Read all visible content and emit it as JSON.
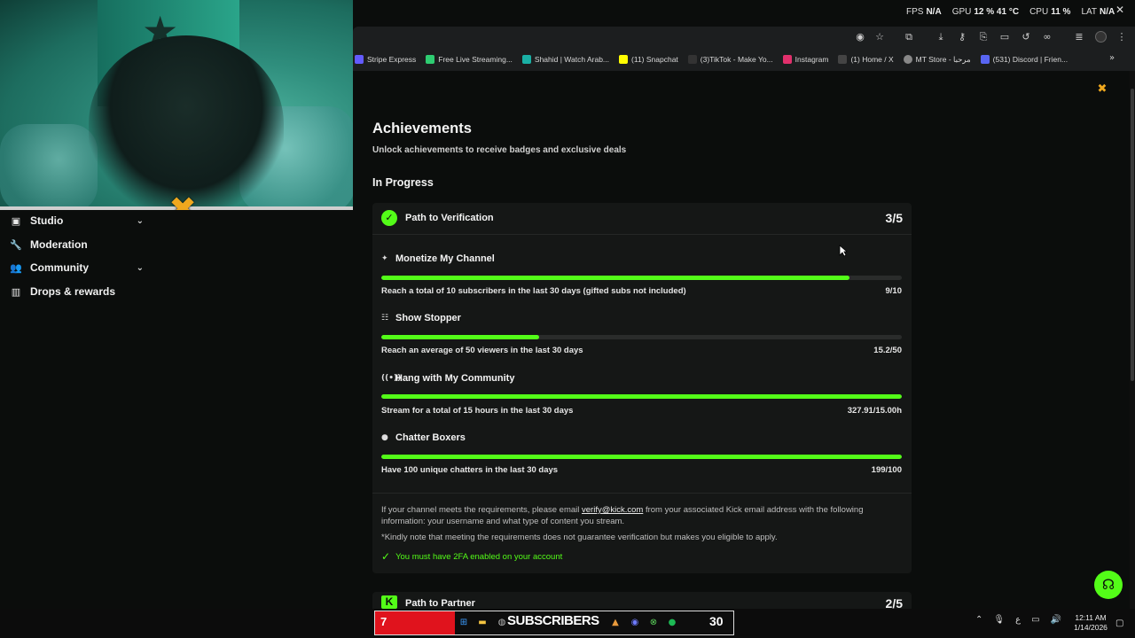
{
  "overlay_stats": [
    {
      "label": "FPS",
      "value": "N/A"
    },
    {
      "label": "GPU",
      "value": "12 % 41 °C"
    },
    {
      "label": "CPU",
      "value": "11 %"
    },
    {
      "label": "LAT",
      "value": "N/A"
    }
  ],
  "bookmarks": [
    {
      "label": "Stripe Express",
      "color": "#635bff"
    },
    {
      "label": "Free Live Streaming...",
      "color": "#2ecc71"
    },
    {
      "label": "Shahid | Watch Arab...",
      "color": "#1ab0a5"
    },
    {
      "label": "(11) Snapchat",
      "color": "#fffc00"
    },
    {
      "label": "(3)TikTok - Make Yo...",
      "color": "#111111"
    },
    {
      "label": "Instagram",
      "color": "#e1306c"
    },
    {
      "label": "(1) Home / X",
      "color": "#000000"
    },
    {
      "label": "MT Store - مرحبا",
      "color": "#888888"
    },
    {
      "label": "(531) Discord | Frien...",
      "color": "#5865f2"
    }
  ],
  "sidebar": {
    "items": [
      {
        "label": "Studio",
        "icon": "studio-icon",
        "expandable": true
      },
      {
        "label": "Moderation",
        "icon": "wrench-icon",
        "expandable": false
      },
      {
        "label": "Community",
        "icon": "people-icon",
        "expandable": true
      },
      {
        "label": "Drops & rewards",
        "icon": "bars-icon",
        "expandable": false
      }
    ]
  },
  "page": {
    "title": "Achievements",
    "subtitle": "Unlock achievements to receive badges and exclusive deals",
    "section": "In Progress"
  },
  "verification": {
    "title": "Path to Verification",
    "count": "3/5",
    "tasks": [
      {
        "title": "Monetize My Channel",
        "icon": "sparkle-icon",
        "desc": "Reach a total of 10 subscribers in the last 30 days (gifted subs not included)",
        "value": "9/10",
        "progress": 0.9
      },
      {
        "title": "Show Stopper",
        "icon": "viewers-icon",
        "desc": "Reach an average of 50 viewers in the last 30 days",
        "value": "15.2/50",
        "progress": 0.304
      },
      {
        "title": "Hang with My Community",
        "icon": "broadcast-icon",
        "desc": "Stream for a total of 15 hours in the last 30 days",
        "value": "327.91/15.00h",
        "progress": 1.0
      },
      {
        "title": "Chatter Boxers",
        "icon": "chat-icon",
        "desc": "Have 100 unique chatters in the last 30 days",
        "value": "199/100",
        "progress": 1.0
      }
    ],
    "info_prefix": "If your channel meets the requirements, please email ",
    "info_email": "verify@kick.com",
    "info_suffix": " from your associated Kick email address with the following information: your username and what type of content you stream.",
    "note": "*Kindly note that meeting the requirements does not guarantee verification but makes you eligible to apply.",
    "requirement": "You must have 2FA enabled on your account"
  },
  "partner": {
    "badge": "K",
    "title": "Path to Partner",
    "count": "2/5"
  },
  "subscriber_widget": {
    "left_number": "7",
    "label": "SUBSCRIBERS",
    "right_number": "30"
  },
  "clock": {
    "time": "12:11 AM",
    "date": "1/14/2026"
  },
  "colors": {
    "accent": "#53fc18",
    "brand_orange": "#f0a81e",
    "widget_red": "#e0131d"
  }
}
